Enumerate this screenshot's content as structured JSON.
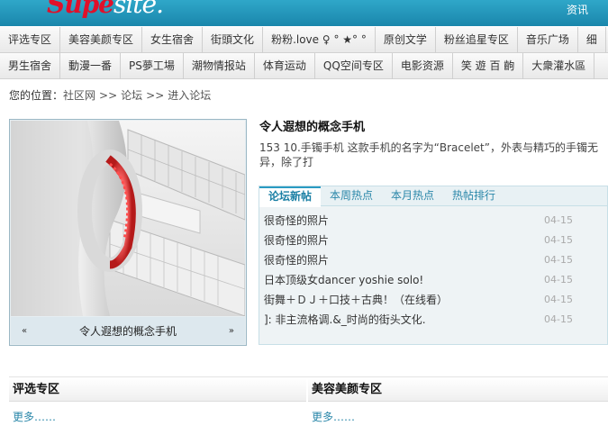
{
  "header": {
    "logo_main": "Supe",
    "logo_suffix": "site.",
    "link": "资讯"
  },
  "nav_row1": [
    "评选专区",
    "美容美颜专区",
    "女生宿舍",
    "街頭文化",
    "粉粉.love ♀ ° ★° °",
    "原创文学",
    "粉丝追星专区",
    "音乐广场",
    "细"
  ],
  "nav_row2": [
    "男生宿舍",
    "動漫一番",
    "PS夢工場",
    "潮物情报站",
    "体育运动",
    "QQ空间专区",
    "电影资源",
    "笑 遊 百 齣",
    "大衆灌水區"
  ],
  "breadcrumb": {
    "label": "您的位置：",
    "items": [
      "社区网",
      "论坛",
      "进入论坛"
    ],
    "sep": ">>"
  },
  "focus": {
    "caption": "令人遐想的概念手机",
    "prev": "«",
    "next": "»"
  },
  "article": {
    "title": "令人遐想的概念手机",
    "summary": "153 10.手镯手机 这款手机的名字为“Bracelet”，外表与精巧的手镯无异，除了打"
  },
  "tabs": {
    "labels": [
      "论坛新帖",
      "本周热点",
      "本月热点",
      "热帖排行"
    ],
    "active": 0,
    "rows": [
      {
        "title": "很奇怪的照片",
        "date": "04-15"
      },
      {
        "title": "很奇怪的照片",
        "date": "04-15"
      },
      {
        "title": "很奇怪的照片",
        "date": "04-15"
      },
      {
        "title": "日本顶级女dancer yoshie solo!",
        "date": "04-15"
      },
      {
        "title": "街舞＋ＤＪ＋口技＋古典！（在线看）",
        "date": "04-15"
      },
      {
        "title": "]: 非主流格调.&_时尚的街头文化.",
        "date": "04-15"
      }
    ]
  },
  "sections": [
    {
      "title": "评选专区",
      "more": "更多……"
    },
    {
      "title": "美容美颜专区",
      "more": "更多……"
    }
  ]
}
